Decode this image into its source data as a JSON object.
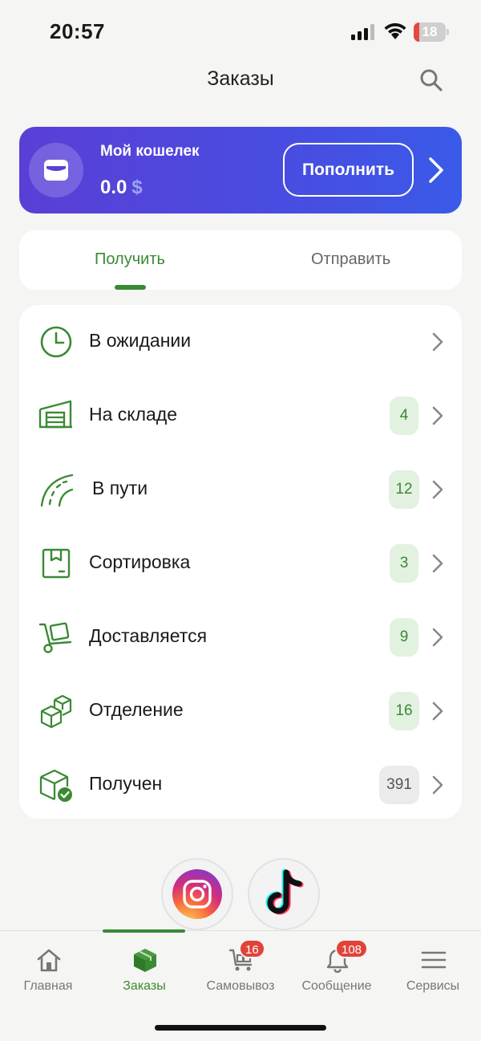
{
  "status_bar": {
    "time": "20:57",
    "battery": "18",
    "battery_level": 0.18
  },
  "header": {
    "title": "Заказы"
  },
  "wallet": {
    "label": "Мой кошелек",
    "amount": "0.0",
    "currency": "$",
    "topup_label": "Пополнить"
  },
  "tabs": [
    {
      "label": "Получить",
      "active": true
    },
    {
      "label": "Отправить",
      "active": false
    }
  ],
  "statuses": [
    {
      "label": "В ожидании",
      "icon": "clock-icon",
      "count": ""
    },
    {
      "label": "На складе",
      "icon": "warehouse-icon",
      "count": "4"
    },
    {
      "label": "В пути",
      "icon": "road-icon",
      "count": "12"
    },
    {
      "label": "Сортировка",
      "icon": "package-box-icon",
      "count": "3"
    },
    {
      "label": "Доставляется",
      "icon": "hand-truck-icon",
      "count": "9"
    },
    {
      "label": "Отделение",
      "icon": "boxes-icon",
      "count": "16"
    },
    {
      "label": "Получен",
      "icon": "box-check-icon",
      "count": "391"
    }
  ],
  "social": [
    {
      "name": "instagram-icon"
    },
    {
      "name": "tiktok-icon"
    }
  ],
  "nav": [
    {
      "label": "Главная",
      "icon": "home-icon",
      "badge": ""
    },
    {
      "label": "Заказы",
      "icon": "cube-icon",
      "badge": "",
      "active": true
    },
    {
      "label": "Самовывоз",
      "icon": "pickup-cart-icon",
      "badge": "16"
    },
    {
      "label": "Сообщение",
      "icon": "bell-icon",
      "badge": "108"
    },
    {
      "label": "Сервисы",
      "icon": "menu-icon",
      "badge": ""
    }
  ],
  "colors": {
    "accent": "#3a8a33",
    "wallet_start": "#5a3fd6",
    "wallet_end": "#3a5ae8",
    "badge": "#e0433b"
  }
}
